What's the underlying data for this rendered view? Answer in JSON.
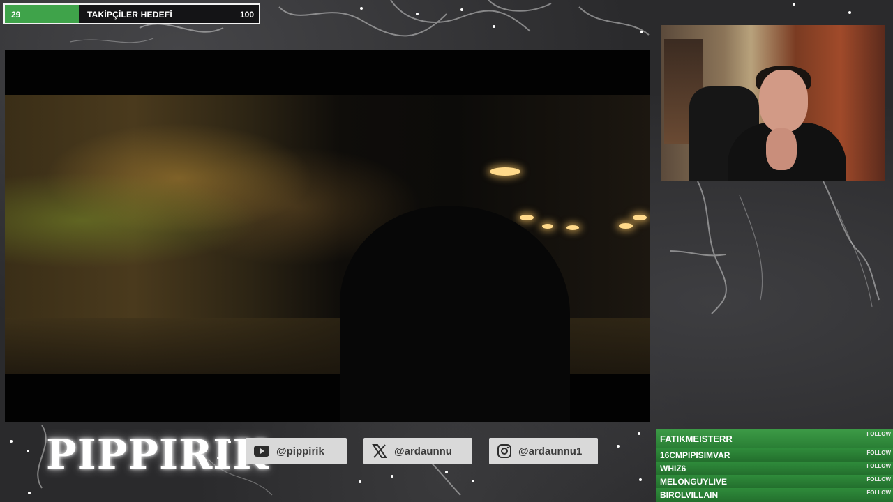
{
  "goal": {
    "current": "29",
    "title": "TAKİPÇİLER HEDEFİ",
    "max": "100",
    "progress_fraction": 0.29,
    "fill_color": "#3fa34a"
  },
  "player": {
    "content": "video-frame"
  },
  "webcam": {
    "content": "streamer-webcam"
  },
  "logo": {
    "text": "PIPPIRIK"
  },
  "socials": [
    {
      "icon": "youtube-icon",
      "handle": "@pippirik"
    },
    {
      "icon": "x-icon",
      "handle": "@ardaunnu"
    },
    {
      "icon": "instagram-icon",
      "handle": "@ardaunnu1"
    }
  ],
  "follows": {
    "tag": "FOLLOW",
    "items": [
      {
        "name": "FATIKMEISTERR"
      },
      {
        "name": "16CMPIPISIMVAR"
      },
      {
        "name": "WHIZ6"
      },
      {
        "name": "MELONGUYLIVE"
      },
      {
        "name": "BIROLVILLAIN"
      }
    ],
    "color": "#2e8b3a"
  }
}
